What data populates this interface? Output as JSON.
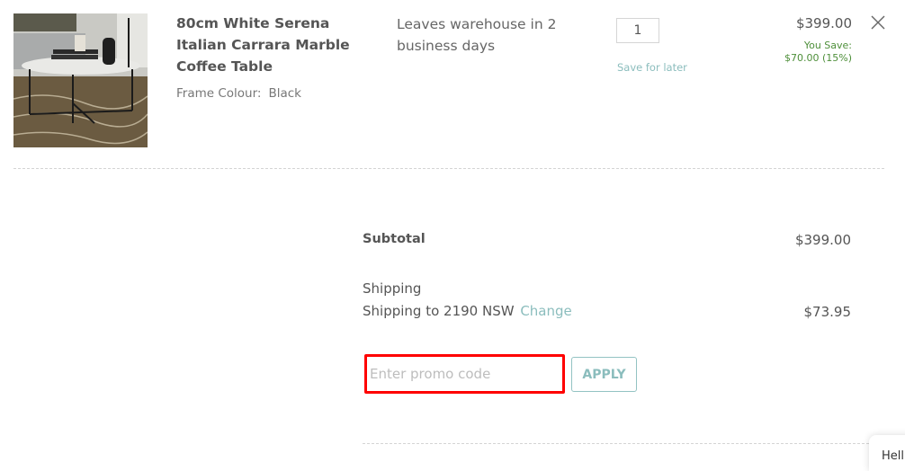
{
  "cart_item": {
    "image_alt": "80cm White Serena Italian Carrara Marble Coffee Table photo",
    "title": "80cm White Serena Italian Carrara Marble Coffee Table",
    "option_label": "Frame Colour:",
    "option_value": "Black",
    "availability": "Leaves warehouse in 2 business days",
    "quantity": "1",
    "save_for_later": "Save for later",
    "price": "$399.00",
    "you_save_label": "You Save:",
    "you_save_value": "$70.00 (15%)",
    "remove_icon": "close-icon"
  },
  "summary": {
    "subtotal_label": "Subtotal",
    "subtotal_value": "$399.00",
    "shipping_label": "Shipping",
    "shipping_to": "Shipping to 2190 NSW",
    "change_link": "Change",
    "shipping_value": "$73.95",
    "promo_placeholder": "Enter promo code",
    "promo_value": "",
    "apply_label": "APPLY"
  },
  "chat_widget": {
    "text": "Hell"
  },
  "colors": {
    "accent_teal": "#8bbdbd",
    "savings_green": "#4e8f3a",
    "highlight_red": "#ff0000"
  }
}
